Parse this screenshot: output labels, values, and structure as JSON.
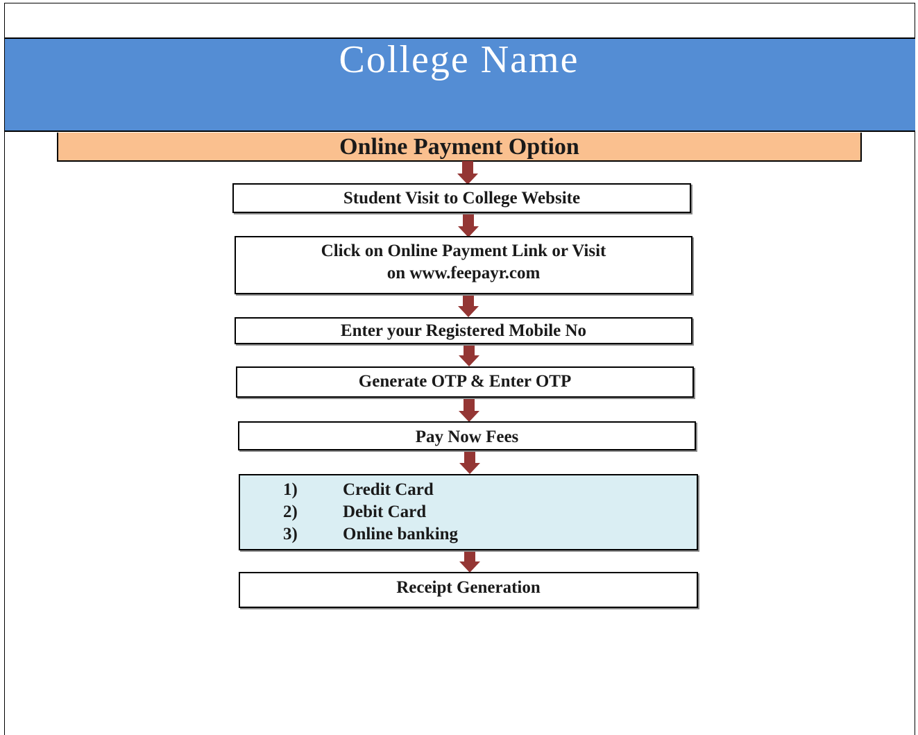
{
  "header": {
    "college_name": "College Name"
  },
  "flow_title": "Online Payment Option",
  "steps": [
    {
      "line1": "Student Visit to College Website"
    },
    {
      "line1": "Click on Online Payment Link or Visit",
      "line2": "on www.feepayr.com"
    },
    {
      "line1": "Enter your Registered Mobile No"
    },
    {
      "line1": "Generate OTP & Enter OTP"
    },
    {
      "line1": "Pay Now Fees"
    }
  ],
  "payment_options": [
    {
      "number": "1)",
      "label": "Credit Card"
    },
    {
      "number": "2)",
      "label": "Debit Card"
    },
    {
      "number": "3)",
      "label": "Online banking"
    }
  ],
  "final_step": "Receipt Generation",
  "colors": {
    "banner": "#548dd4",
    "heading": "#fac08f",
    "options_box": "#daeef3",
    "arrow": "#943634"
  },
  "connector": "arrow-down-icon"
}
